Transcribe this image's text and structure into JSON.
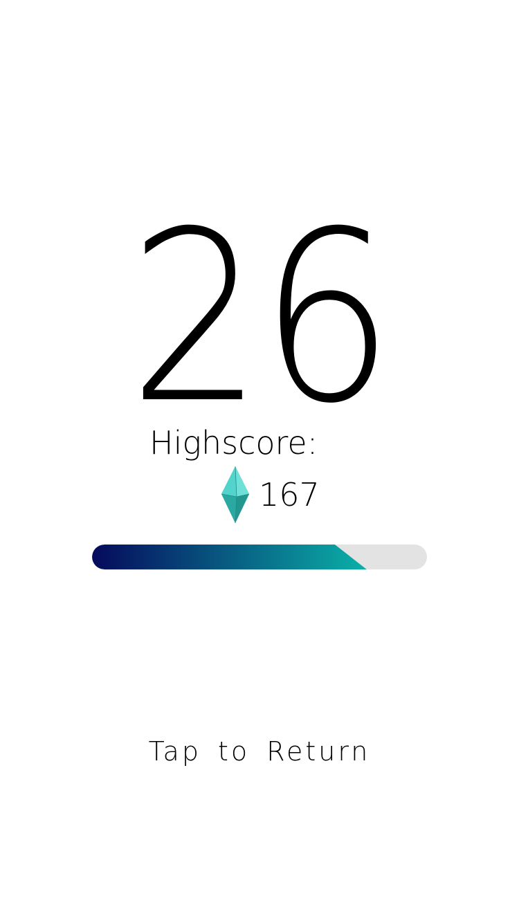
{
  "game": {
    "score": "26",
    "highscore_label": "Highscore:",
    "gem_count": "167",
    "gem_icon": "diamond-gem-icon",
    "progress": 0.82,
    "tap_label": "Tap to Return"
  },
  "colors": {
    "background": "#ffffff",
    "text": "#000000",
    "progress_start": "#050a5c",
    "progress_end": "#0bb0a8",
    "progress_track": "#e3e3e3",
    "gem_light": "#7ee8e0",
    "gem_dark": "#2fb8b0"
  }
}
